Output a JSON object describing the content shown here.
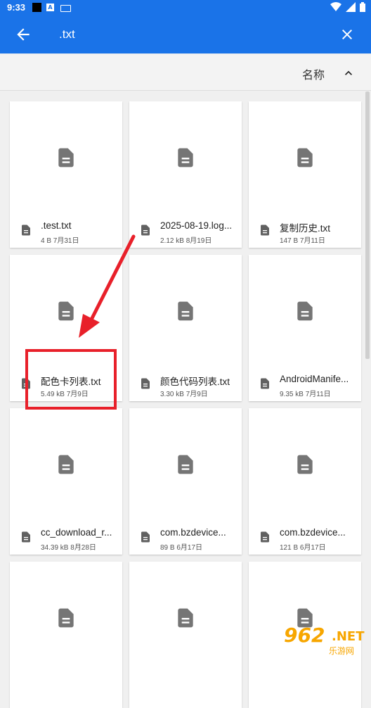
{
  "status_bar": {
    "time": "9:33",
    "icon_label": "A"
  },
  "toolbar": {
    "title": ".txt",
    "back_icon": "arrow-back-icon",
    "close_icon": "close-icon"
  },
  "sort": {
    "label": "名称",
    "icon": "chevron-up-icon"
  },
  "files": [
    {
      "name": ".test.txt",
      "meta": "4 B 7月31日"
    },
    {
      "name": "2025-08-19.log...",
      "meta": "2.12 kB 8月19日"
    },
    {
      "name": "复制历史.txt",
      "meta": "147 B 7月11日"
    },
    {
      "name": "配色卡列表.txt",
      "meta": "5.49 kB 7月9日"
    },
    {
      "name": "颜色代码列表.txt",
      "meta": "3.30 kB 7月9日"
    },
    {
      "name": "AndroidManife...",
      "meta": "9.35 kB 7月11日"
    },
    {
      "name": "cc_download_r...",
      "meta": "34.39 kB 8月28日"
    },
    {
      "name": "com.bzdevice...",
      "meta": "89 B 6月17日"
    },
    {
      "name": "com.bzdevice...",
      "meta": "121 B 6月17日"
    },
    {
      "name": "",
      "meta": ""
    },
    {
      "name": "",
      "meta": ""
    },
    {
      "name": "",
      "meta": ""
    }
  ],
  "watermark": {
    "number": "962",
    "suffix": ".NET",
    "text": "乐游网"
  },
  "colors": {
    "primary": "#1a73e8",
    "highlight": "#e8202a",
    "watermark": "#f7a600"
  }
}
